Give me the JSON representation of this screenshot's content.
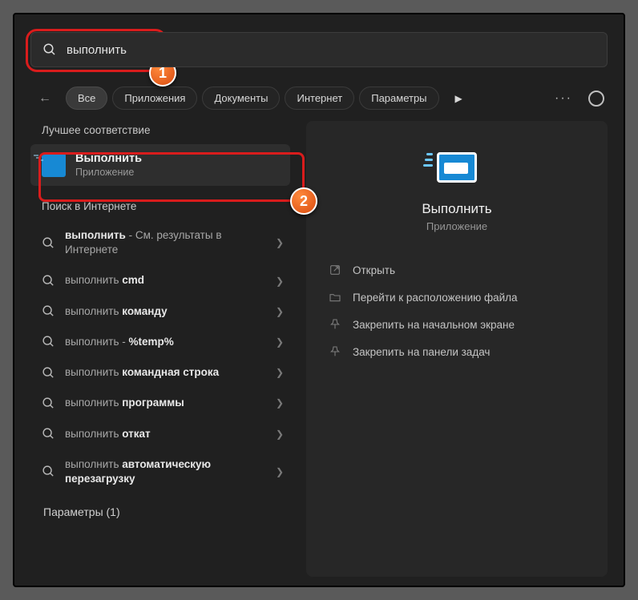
{
  "search": {
    "value": "выполнить"
  },
  "tabs": {
    "back": "←",
    "items": [
      "Все",
      "Приложения",
      "Документы",
      "Интернет",
      "Параметры"
    ],
    "active_index": 0
  },
  "sections": {
    "best_match": "Лучшее соответствие",
    "web_search": "Поиск в Интернете",
    "params": "Параметры (1)"
  },
  "best_match": {
    "title": "Выполнить",
    "subtitle": "Приложение"
  },
  "web_results": [
    {
      "prefix": "выполнить",
      "suffix": " - См. результаты в Интернете"
    },
    {
      "prefix": "выполнить ",
      "suffix": "cmd"
    },
    {
      "prefix": "выполнить ",
      "bold": "команду"
    },
    {
      "prefix": "выполнить - ",
      "bold": "%temp%"
    },
    {
      "prefix": "выполнить ",
      "bold": "командная строка"
    },
    {
      "prefix": "выполнить ",
      "bold": "программы"
    },
    {
      "prefix": "выполнить ",
      "bold": "откат"
    },
    {
      "prefix": "выполнить ",
      "bold": "автоматическую перезагрузку"
    }
  ],
  "details": {
    "title": "Выполнить",
    "subtitle": "Приложение",
    "actions": [
      {
        "icon": "open",
        "label": "Открыть"
      },
      {
        "icon": "folder",
        "label": "Перейти к расположению файла"
      },
      {
        "icon": "pin",
        "label": "Закрепить на начальном экране"
      },
      {
        "icon": "pin",
        "label": "Закрепить на панели задач"
      }
    ]
  },
  "badges": {
    "one": "1",
    "two": "2"
  }
}
